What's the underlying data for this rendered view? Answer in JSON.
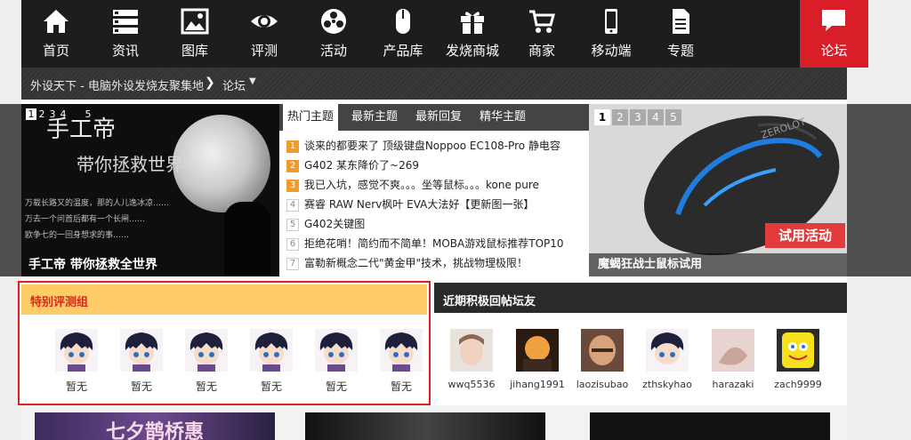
{
  "nav": {
    "items": [
      {
        "label": "首页",
        "icon": "home-icon"
      },
      {
        "label": "资讯",
        "icon": "list-icon"
      },
      {
        "label": "图库",
        "icon": "image-icon"
      },
      {
        "label": "评测",
        "icon": "eye-icon"
      },
      {
        "label": "活动",
        "icon": "fan-icon"
      },
      {
        "label": "产品库",
        "icon": "mouse-icon"
      },
      {
        "label": "发烧商城",
        "icon": "gift-icon"
      },
      {
        "label": "商家",
        "icon": "cart-icon"
      },
      {
        "label": "移动端",
        "icon": "phone-icon"
      },
      {
        "label": "专题",
        "icon": "document-icon"
      }
    ],
    "forum": {
      "label": "论坛",
      "icon": "chat-icon"
    },
    "colors": {
      "bar": "#1d1d1d",
      "forum": "#d91e29"
    }
  },
  "breadcrumb": {
    "site": "外设天下 - 电脑外设发烧友聚集地",
    "current": "论坛"
  },
  "hero_left": {
    "pager": [
      "1",
      "2",
      "3",
      "4",
      "5"
    ],
    "title_calligraphy": "手工帝",
    "subtitle_calligraphy": "带你拯救世界",
    "caption": "手工帝 带你拯救全世界"
  },
  "hot": {
    "tabs": [
      "热门主题",
      "最新主题",
      "最新回复",
      "精华主题"
    ],
    "rows": [
      {
        "num": "1",
        "text": "谈来的都要来了 顶级键盘Noppoo EC108-Pro 静电容"
      },
      {
        "num": "2",
        "text": "G402 某东降价了~269"
      },
      {
        "num": "3",
        "text": "我已入坑，感觉不爽。。。坐等鼠标。。。kone pure"
      },
      {
        "num": "4",
        "text": "赛睿 RAW Nerv枫叶 EVA大法好【更新图一张】"
      },
      {
        "num": "5",
        "text": "G402关键图"
      },
      {
        "num": "6",
        "text": "拒绝花哨！简约而不简单！MOBA游戏鼠标推荐TOP10"
      },
      {
        "num": "7",
        "text": "富勒新概念二代\"黄金甲\"技术，挑战物理极限！"
      }
    ]
  },
  "hero_right": {
    "pager": [
      "1",
      "2",
      "3",
      "4",
      "5"
    ],
    "badge": "试用活动",
    "caption": "魔蝎狂战士鼠标试用",
    "mouse_brand": "ZEROLOT"
  },
  "special": {
    "title": "特别评测组",
    "members": [
      "暂无",
      "暂无",
      "暂无",
      "暂无",
      "暂无",
      "暂无"
    ]
  },
  "recent": {
    "title": "近期积极回帖坛友",
    "users": [
      {
        "name": "wwq5536"
      },
      {
        "name": "jihang1991"
      },
      {
        "name": "laozisubao"
      },
      {
        "name": "zthskyhao"
      },
      {
        "name": "harazaki"
      },
      {
        "name": "zach9999"
      }
    ]
  },
  "banners": {
    "first_text": "七夕鹊桥惠"
  }
}
